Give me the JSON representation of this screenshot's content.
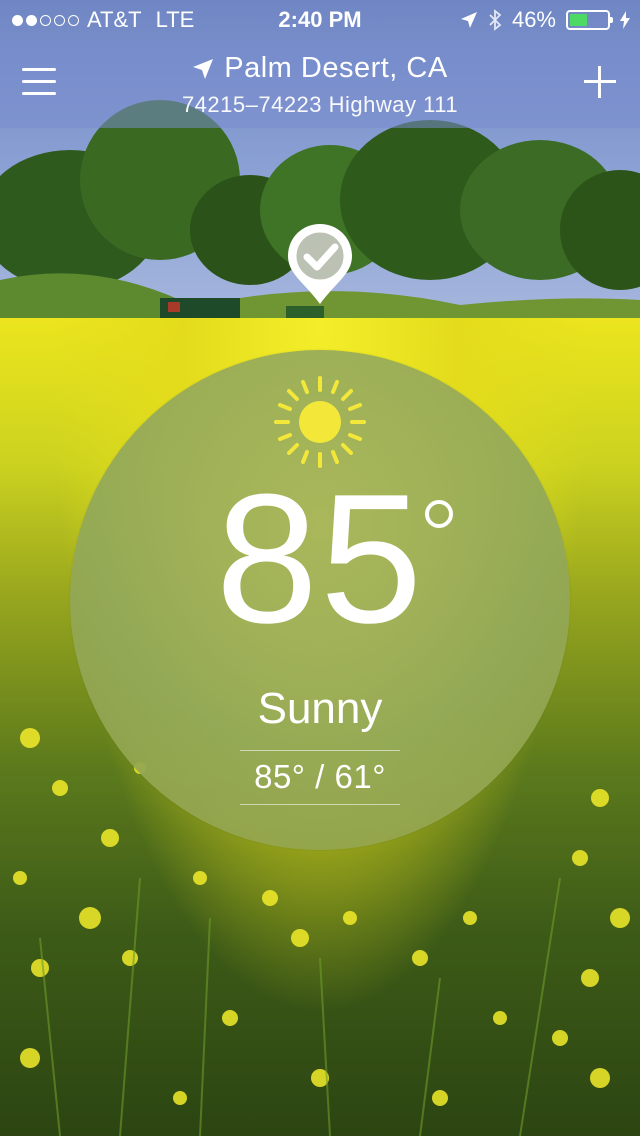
{
  "status_bar": {
    "carrier": "AT&T",
    "network": "LTE",
    "time": "2:40 PM",
    "battery_percent": "46%",
    "signal_bars": 2,
    "signal_total": 5,
    "battery_level": 0.46,
    "battery_color": "#4cd964",
    "icons": [
      "location-arrow-icon",
      "bluetooth-icon",
      "battery-icon",
      "charging-bolt-icon"
    ]
  },
  "nav": {
    "location_name": "Palm Desert, CA",
    "address": "74215–74223 Highway 111",
    "menu_icon": "hamburger-menu-icon",
    "add_icon": "plus-icon"
  },
  "map_pin": {
    "icon": "check-marker-icon"
  },
  "weather": {
    "temperature": "85",
    "condition": "Sunny",
    "hi_lo": "85° / 61°",
    "icon": "sun-icon"
  }
}
